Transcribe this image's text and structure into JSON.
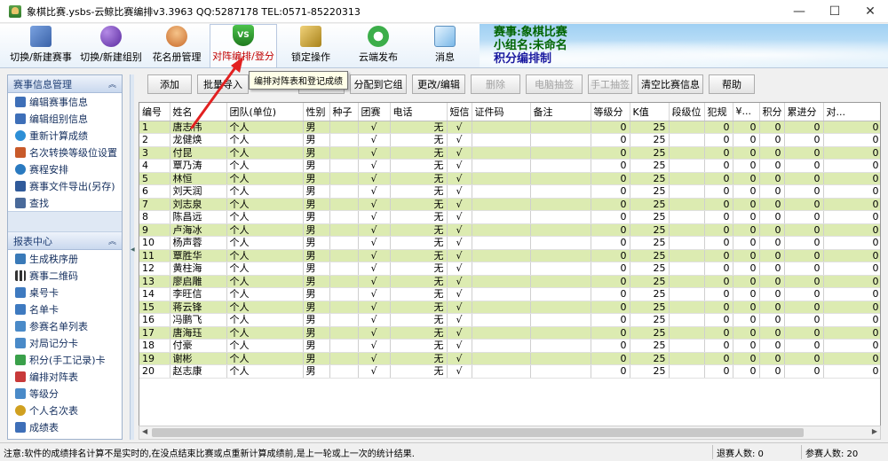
{
  "window": {
    "title": "象棋比赛.ysbs-云鲸比赛编排v3.3963 QQ:5287178 TEL:0571-85220313",
    "min": "—",
    "max": "☐",
    "close": "✕"
  },
  "toolbar": {
    "items": [
      {
        "label": "切换/新建赛事",
        "icon": "tournament-icon",
        "color": "#5a7fc8"
      },
      {
        "label": "切换/新建组别",
        "icon": "group-icon",
        "color": "#7a4cc0"
      },
      {
        "label": "花名册管理",
        "icon": "roster-icon",
        "color": "#e08c3a"
      },
      {
        "label": "对阵编排/登分",
        "icon": "vs-shield-icon",
        "color": "#2e9a2e"
      },
      {
        "label": "锁定操作",
        "icon": "lock-icon",
        "color": "#c9a23a"
      },
      {
        "label": "云端发布",
        "icon": "cloud-publish-icon",
        "color": "#3cae4a"
      },
      {
        "label": "消息",
        "icon": "message-icon",
        "color": "#4aa0d8"
      }
    ],
    "info": {
      "event": "赛事:象棋比赛",
      "group": "小组名:未命名",
      "mode": "积分编排制"
    }
  },
  "tooltip": "编排对阵表和登记成绩",
  "actions": [
    {
      "label": "添加",
      "enabled": true
    },
    {
      "label": "批量导入",
      "enabled": true
    },
    {
      "label": "",
      "enabled": true
    },
    {
      "label": "分配到它组",
      "enabled": true
    },
    {
      "label": "更改/编辑",
      "enabled": true
    },
    {
      "label": "删除",
      "enabled": false
    },
    {
      "label": "电脑抽签",
      "enabled": false
    },
    {
      "label": "手工抽签",
      "enabled": false
    },
    {
      "label": "清空比赛信息",
      "enabled": true
    },
    {
      "label": "帮助",
      "enabled": true
    }
  ],
  "sidebar": {
    "section1": {
      "title": "赛事信息管理",
      "items": [
        {
          "label": "编辑赛事信息",
          "icon": "edit-event-icon",
          "color": "#3e6fb8"
        },
        {
          "label": "编辑组别信息",
          "icon": "edit-group-icon",
          "color": "#3e6fb8"
        },
        {
          "label": "重新计算成绩",
          "icon": "recalculate-icon",
          "color": "#2d8fd6"
        },
        {
          "label": "名次转换等级位设置",
          "icon": "rank-convert-icon",
          "color": "#c85a2a"
        },
        {
          "label": "赛程安排",
          "icon": "schedule-icon",
          "color": "#2a7ac0"
        },
        {
          "label": "赛事文件导出(另存)",
          "icon": "export-icon",
          "color": "#305a9a"
        },
        {
          "label": "查找",
          "icon": "find-icon",
          "color": "#4a6a9a"
        }
      ]
    },
    "section2": {
      "title": "报表中心",
      "items": [
        {
          "label": "生成秩序册",
          "icon": "order-book-icon",
          "color": "#3a7ab8"
        },
        {
          "label": "赛事二维码",
          "icon": "qrcode-icon",
          "color": "#333333"
        },
        {
          "label": "桌号卡",
          "icon": "table-card-icon",
          "color": "#3e7ac0"
        },
        {
          "label": "名单卡",
          "icon": "name-card-icon",
          "color": "#3e7ac0"
        },
        {
          "label": "参赛名单列表",
          "icon": "player-list-icon",
          "color": "#4a8ac8"
        },
        {
          "label": "对局记分卡",
          "icon": "scorecard-icon",
          "color": "#4a8ac8"
        },
        {
          "label": "积分(手工记录)卡",
          "icon": "manual-score-icon",
          "color": "#3aa04a"
        },
        {
          "label": "编排对阵表",
          "icon": "pairing-table-icon",
          "color": "#c83a3a"
        },
        {
          "label": "等级分",
          "icon": "rating-icon",
          "color": "#4a8ac8"
        },
        {
          "label": "个人名次表",
          "icon": "personal-rank-icon",
          "color": "#d0a020"
        },
        {
          "label": "成绩表",
          "icon": "results-icon",
          "color": "#3e6fb8"
        }
      ]
    }
  },
  "grid": {
    "columns": [
      "编号",
      "姓名",
      "团队(单位)",
      "性别",
      "种子",
      "团赛",
      "电话",
      "短信",
      "证件码",
      "备注",
      "等级分",
      "K值",
      "段级位",
      "犯规",
      "¥...",
      "积分",
      "累进分",
      "对..."
    ],
    "rows": [
      [
        "1",
        "唐志伟",
        "个人",
        "男",
        "",
        "√",
        "无",
        "√",
        "",
        "",
        "0",
        "25",
        "",
        "0",
        "0",
        "0",
        "0",
        "0"
      ],
      [
        "2",
        "龙健焕",
        "个人",
        "男",
        "",
        "√",
        "无",
        "√",
        "",
        "",
        "0",
        "25",
        "",
        "0",
        "0",
        "0",
        "0",
        "0"
      ],
      [
        "3",
        "付昆",
        "个人",
        "男",
        "",
        "√",
        "无",
        "√",
        "",
        "",
        "0",
        "25",
        "",
        "0",
        "0",
        "0",
        "0",
        "0"
      ],
      [
        "4",
        "覃乃涛",
        "个人",
        "男",
        "",
        "√",
        "无",
        "√",
        "",
        "",
        "0",
        "25",
        "",
        "0",
        "0",
        "0",
        "0",
        "0"
      ],
      [
        "5",
        "林恒",
        "个人",
        "男",
        "",
        "√",
        "无",
        "√",
        "",
        "",
        "0",
        "25",
        "",
        "0",
        "0",
        "0",
        "0",
        "0"
      ],
      [
        "6",
        "刘天润",
        "个人",
        "男",
        "",
        "√",
        "无",
        "√",
        "",
        "",
        "0",
        "25",
        "",
        "0",
        "0",
        "0",
        "0",
        "0"
      ],
      [
        "7",
        "刘志泉",
        "个人",
        "男",
        "",
        "√",
        "无",
        "√",
        "",
        "",
        "0",
        "25",
        "",
        "0",
        "0",
        "0",
        "0",
        "0"
      ],
      [
        "8",
        "陈昌远",
        "个人",
        "男",
        "",
        "√",
        "无",
        "√",
        "",
        "",
        "0",
        "25",
        "",
        "0",
        "0",
        "0",
        "0",
        "0"
      ],
      [
        "9",
        "卢海冰",
        "个人",
        "男",
        "",
        "√",
        "无",
        "√",
        "",
        "",
        "0",
        "25",
        "",
        "0",
        "0",
        "0",
        "0",
        "0"
      ],
      [
        "10",
        "杨声蓉",
        "个人",
        "男",
        "",
        "√",
        "无",
        "√",
        "",
        "",
        "0",
        "25",
        "",
        "0",
        "0",
        "0",
        "0",
        "0"
      ],
      [
        "11",
        "覃胜华",
        "个人",
        "男",
        "",
        "√",
        "无",
        "√",
        "",
        "",
        "0",
        "25",
        "",
        "0",
        "0",
        "0",
        "0",
        "0"
      ],
      [
        "12",
        "黄柱海",
        "个人",
        "男",
        "",
        "√",
        "无",
        "√",
        "",
        "",
        "0",
        "25",
        "",
        "0",
        "0",
        "0",
        "0",
        "0"
      ],
      [
        "13",
        "廖启雕",
        "个人",
        "男",
        "",
        "√",
        "无",
        "√",
        "",
        "",
        "0",
        "25",
        "",
        "0",
        "0",
        "0",
        "0",
        "0"
      ],
      [
        "14",
        "李旺信",
        "个人",
        "男",
        "",
        "√",
        "无",
        "√",
        "",
        "",
        "0",
        "25",
        "",
        "0",
        "0",
        "0",
        "0",
        "0"
      ],
      [
        "15",
        "蒋云锋",
        "个人",
        "男",
        "",
        "√",
        "无",
        "√",
        "",
        "",
        "0",
        "25",
        "",
        "0",
        "0",
        "0",
        "0",
        "0"
      ],
      [
        "16",
        "冯鹏飞",
        "个人",
        "男",
        "",
        "√",
        "无",
        "√",
        "",
        "",
        "0",
        "25",
        "",
        "0",
        "0",
        "0",
        "0",
        "0"
      ],
      [
        "17",
        "唐海珏",
        "个人",
        "男",
        "",
        "√",
        "无",
        "√",
        "",
        "",
        "0",
        "25",
        "",
        "0",
        "0",
        "0",
        "0",
        "0"
      ],
      [
        "18",
        "付豪",
        "个人",
        "男",
        "",
        "√",
        "无",
        "√",
        "",
        "",
        "0",
        "25",
        "",
        "0",
        "0",
        "0",
        "0",
        "0"
      ],
      [
        "19",
        "谢彬",
        "个人",
        "男",
        "",
        "√",
        "无",
        "√",
        "",
        "",
        "0",
        "25",
        "",
        "0",
        "0",
        "0",
        "0",
        "0"
      ],
      [
        "20",
        "赵志康",
        "个人",
        "男",
        "",
        "√",
        "无",
        "√",
        "",
        "",
        "0",
        "25",
        "",
        "0",
        "0",
        "0",
        "0",
        "0"
      ]
    ]
  },
  "status": {
    "message": "注意:软件的成绩排名计算不是实时的,在没点结束比赛或点重新计算成绩前,是上一轮或上一次的统计结果.",
    "withdrawn": "退赛人数: 0",
    "participants": "参赛人数: 20"
  },
  "colors": {
    "row_alt": "#dcebb1",
    "accent_red": "#c00000"
  }
}
